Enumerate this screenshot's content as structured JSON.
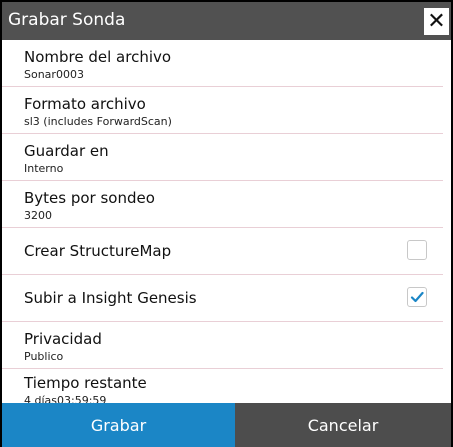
{
  "dialog": {
    "title": "Grabar Sonda",
    "close_icon": "close-icon"
  },
  "rows": [
    {
      "label": "Nombre del archivo",
      "value": "Sonar0003"
    },
    {
      "label": "Formato archivo",
      "value": "sl3 (includes ForwardScan)"
    },
    {
      "label": "Guardar en",
      "value": "Interno"
    },
    {
      "label": "Bytes por sondeo",
      "value": "3200"
    },
    {
      "label": "Crear StructureMap",
      "checked": false
    },
    {
      "label": "Subir a Insight Genesis",
      "checked": true
    },
    {
      "label": "Privacidad",
      "value": "Publico"
    },
    {
      "label": "Tiempo restante",
      "value": "4 días03:59:59"
    }
  ],
  "buttons": {
    "primary": "Grabar",
    "secondary": "Cancelar"
  },
  "colors": {
    "accent": "#1b86c6",
    "titlebar": "#515151",
    "secondary_button": "#4d4d4d"
  }
}
